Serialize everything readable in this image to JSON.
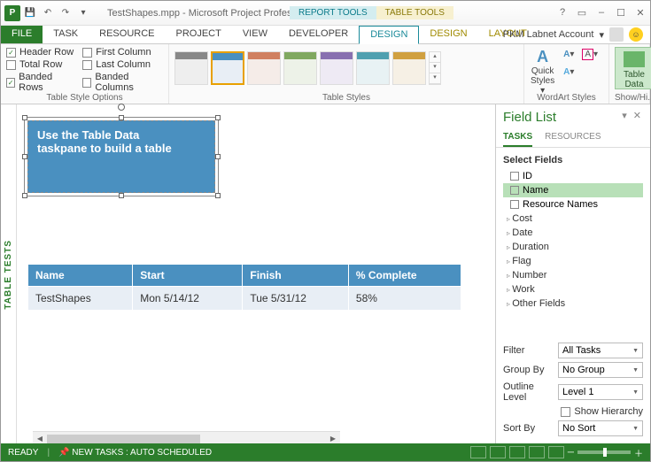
{
  "titlebar": {
    "title": "TestShapes.mpp - Microsoft Project Professi...",
    "tools": {
      "report": "REPORT TOOLS",
      "table": "TABLE TOOLS"
    }
  },
  "tabs": {
    "file": "FILE",
    "task": "TASK",
    "resource": "RESOURCE",
    "project": "PROJECT",
    "view": "VIEW",
    "developer": "DEVELOPER",
    "design1": "DESIGN",
    "design2": "DESIGN",
    "layout": "LAYOUT"
  },
  "account": {
    "name": "PKM Labnet Account"
  },
  "ribbon": {
    "tso": {
      "label": "Table Style Options",
      "headerRow": "Header Row",
      "totalRow": "Total Row",
      "bandedRows": "Banded Rows",
      "firstCol": "First Column",
      "lastCol": "Last Column",
      "bandedCols": "Banded Columns"
    },
    "tstyles": {
      "label": "Table Styles"
    },
    "wa": {
      "label": "WordArt Styles",
      "quick": "Quick Styles"
    },
    "sh": {
      "label": "Show/Hi...",
      "btn": "Table Data"
    }
  },
  "sidetab": "TABLE TESTS",
  "callout": {
    "line1": "Use the Table Data",
    "line2": "taskpane to build a table"
  },
  "table": {
    "headers": {
      "name": "Name",
      "start": "Start",
      "finish": "Finish",
      "pct": "% Complete"
    },
    "rows": [
      {
        "name": "TestShapes",
        "start": "Mon 5/14/12",
        "finish": "Tue 5/31/12",
        "pct": "58%"
      }
    ]
  },
  "pane": {
    "title": "Field List",
    "tabTasks": "TASKS",
    "tabRes": "RESOURCES",
    "select": "Select Fields",
    "fields": {
      "id": "ID",
      "name": "Name",
      "resNames": "Resource Names"
    },
    "groups": [
      "Cost",
      "Date",
      "Duration",
      "Flag",
      "Number",
      "Work",
      "Other Fields"
    ],
    "filter": {
      "label": "Filter",
      "value": "All Tasks"
    },
    "groupBy": {
      "label": "Group By",
      "value": "No Group"
    },
    "outline": {
      "label": "Outline Level",
      "value": "Level 1"
    },
    "showH": "Show Hierarchy",
    "sort": {
      "label": "Sort By",
      "value": "No Sort"
    }
  },
  "status": {
    "ready": "READY",
    "sched": "NEW TASKS : AUTO SCHEDULED"
  }
}
